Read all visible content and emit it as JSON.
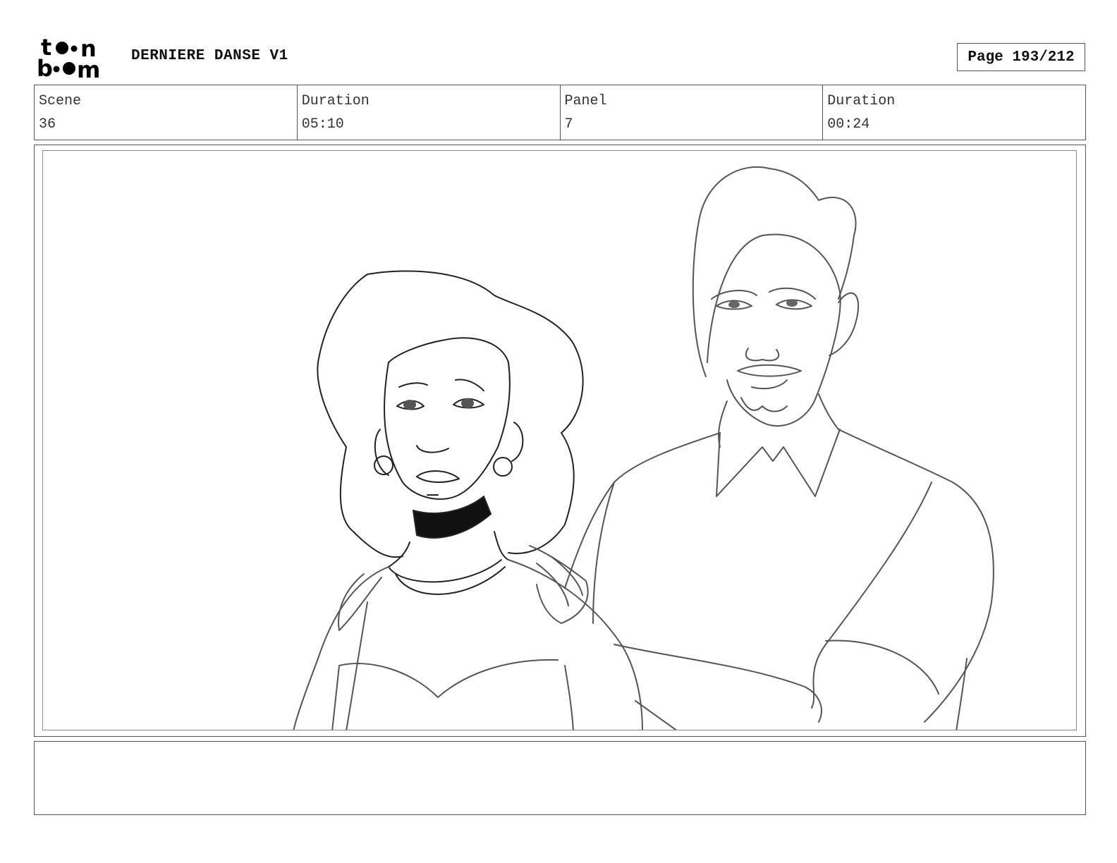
{
  "header": {
    "logo_top": "toon",
    "logo_bottom": "boom",
    "title": "DERNIERE DANSE V1",
    "page_label": "Page 193/212"
  },
  "info": [
    {
      "label": "Scene",
      "value": "36"
    },
    {
      "label": "Duration",
      "value": "05:10"
    },
    {
      "label": "Panel",
      "value": "7"
    },
    {
      "label": "Duration",
      "value": "00:24"
    }
  ],
  "notes": {
    "text": ""
  }
}
